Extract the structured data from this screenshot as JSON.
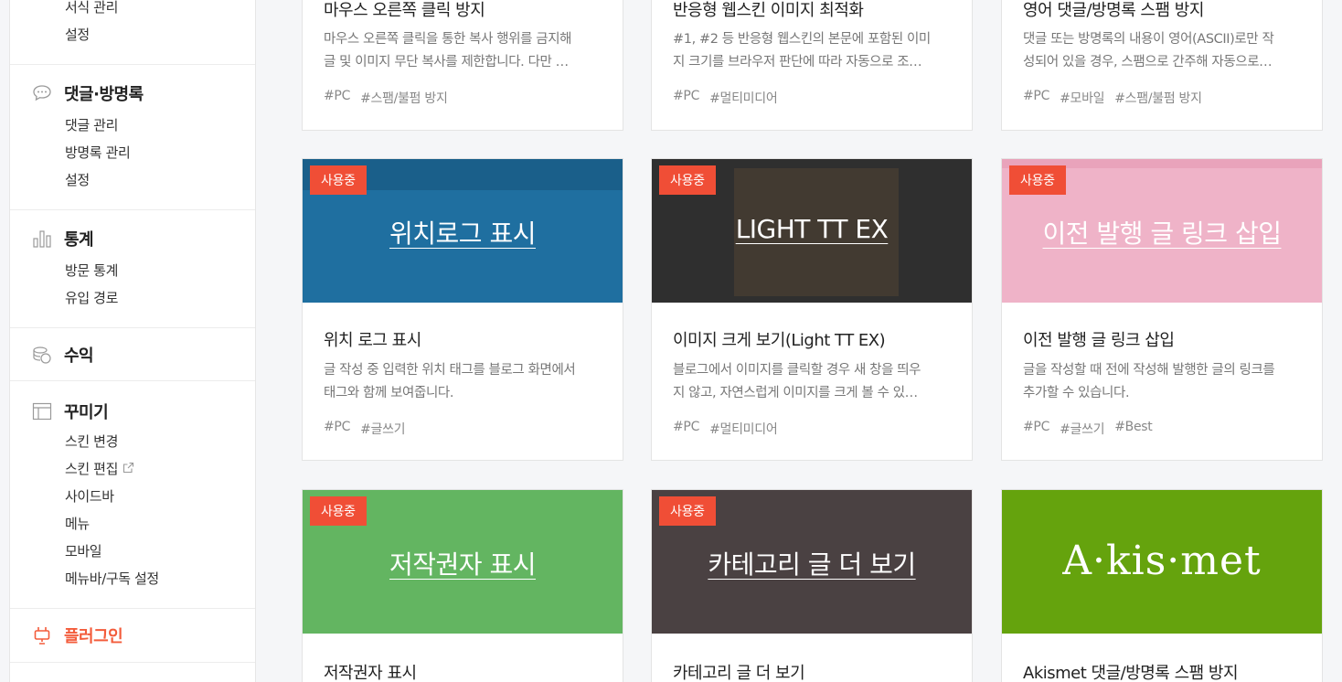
{
  "sidebar": {
    "top_items": [
      "서식 관리",
      "설정"
    ],
    "comments": {
      "title": "댓글·방명록",
      "items": [
        "댓글 관리",
        "방명록 관리",
        "설정"
      ]
    },
    "stats": {
      "title": "통계",
      "items": [
        "방문 통계",
        "유입 경로"
      ]
    },
    "revenue": {
      "title": "수익"
    },
    "design": {
      "title": "꾸미기",
      "items": [
        "스킨 변경",
        "스킨 편집",
        "사이드바",
        "메뉴",
        "모바일",
        "메뉴바/구독 설정"
      ]
    },
    "plugin": {
      "title": "플러그인"
    }
  },
  "badge_label": "사용중",
  "cards": [
    {
      "title": "마우스 오른쪽 클릭 방지",
      "desc": [
        "마우스 오른쪽 클릭을 통한 복사 행위를 금지해",
        "글 및 이미지 무단 복사를 제한합니다. 다만 …"
      ],
      "tags": [
        "#PC",
        "#스팸/불펌 방지"
      ]
    },
    {
      "title": "반응형 웹스킨 이미지 최적화",
      "desc": [
        "#1, #2 등 반응형 웹스킨의 본문에 포함된 이미",
        "지 크기를 브라우저 판단에 따라 자동으로 조…"
      ],
      "tags": [
        "#PC",
        "#멀티미디어"
      ]
    },
    {
      "title": "영어 댓글/방명록 스팸 방지",
      "desc": [
        "댓글 또는 방명록의 내용이 영어(ASCII)로만 작",
        "성되어 있을 경우, 스팸으로 간주해 자동으로…"
      ],
      "tags": [
        "#PC",
        "#모바일",
        "#스팸/불펌 방지"
      ]
    },
    {
      "thumb_title": "위치로그 표시",
      "title": "위치 로그 표시",
      "desc": [
        "글 작성 중 입력한 위치 태그를 블로그 화면에서",
        "태그와 함께 보여줍니다."
      ],
      "tags": [
        "#PC",
        "#글쓰기"
      ],
      "thumb_color": "#1f6fa0"
    },
    {
      "thumb_title": "LIGHT TT EX",
      "title": "이미지 크게 보기(Light TT EX)",
      "desc": [
        "블로그에서 이미지를 클릭할 경우 새 창을 띄우",
        "지 않고, 자연스럽게 이미지를 크게 볼 수 있…"
      ],
      "tags": [
        "#PC",
        "#멀티미디어"
      ],
      "thumb_color": "#2f2f2f"
    },
    {
      "thumb_title": "이전 발행 글 링크 삽입",
      "title": "이전 발행 글 링크 삽입",
      "desc": [
        "글을 작성할 때 전에 작성해 발행한 글의 링크를",
        "추가할 수 있습니다."
      ],
      "tags": [
        "#PC",
        "#글쓰기",
        "#Best"
      ],
      "thumb_color": "#efb3c8"
    },
    {
      "thumb_title": "저작권자 표시",
      "title": "저작권자 표시",
      "thumb_color": "#63b561"
    },
    {
      "thumb_title": "카테고리 글 더 보기",
      "title": "카테고리 글 더 보기",
      "thumb_color": "#4a4142"
    },
    {
      "thumb_title": "A·kis·met",
      "title": "Akismet 댓글/방명록 스팸 방지",
      "thumb_color": "#65a30d"
    }
  ],
  "colors": {
    "accent": "#f35c3b",
    "badge": "#f04e36",
    "page_bg": "#f5f6f8"
  }
}
